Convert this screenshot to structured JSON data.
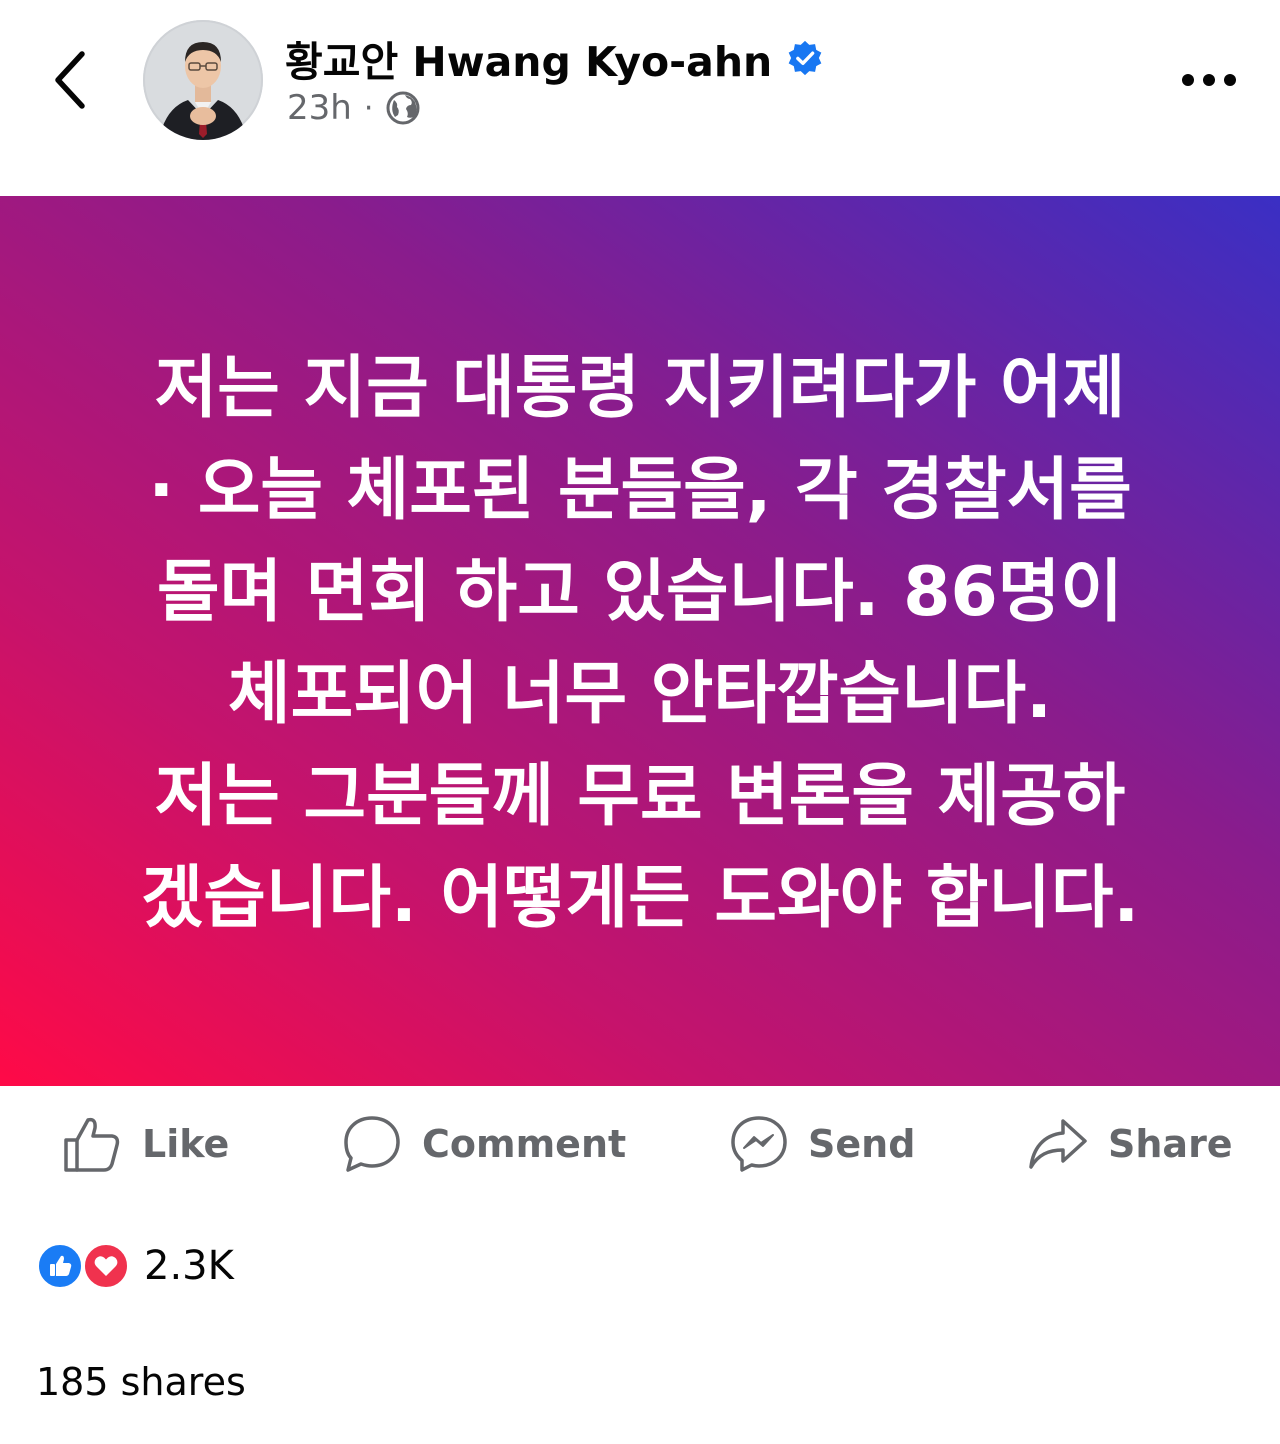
{
  "header": {
    "author_name": "황교안 Hwang Kyo-ahn",
    "timestamp": "23h",
    "separator": "·",
    "privacy_icon": "globe-icon",
    "verified_icon": "verified-badge-icon",
    "back_icon": "chevron-left-icon",
    "more_icon": "more-options-icon"
  },
  "post": {
    "lines": [
      "저는 지금 대통령 지키려다가 어제",
      "· 오늘 체포된 분들을, 각 경찰서를",
      "돌며 면회 하고 있습니다. 86명이",
      "체포되어 너무 안타깝습니다.",
      "저는 그분들께 무료 변론을 제공하",
      "겠습니다. 어떻게든 도와야 합니다."
    ],
    "background_colors": [
      "#ff0a47",
      "#c5136c",
      "#8a1c8c",
      "#3a2fc4"
    ]
  },
  "actions": {
    "like_label": "Like",
    "comment_label": "Comment",
    "send_label": "Send",
    "share_label": "Share"
  },
  "reactions": {
    "count": "2.3K",
    "types": [
      "like",
      "love"
    ]
  },
  "shares": {
    "label": "185 shares"
  },
  "colors": {
    "verified_blue": "#1877f2",
    "muted_text": "#65676b",
    "like_blue": "#1a7cf5",
    "love_red": "#f0324e"
  }
}
